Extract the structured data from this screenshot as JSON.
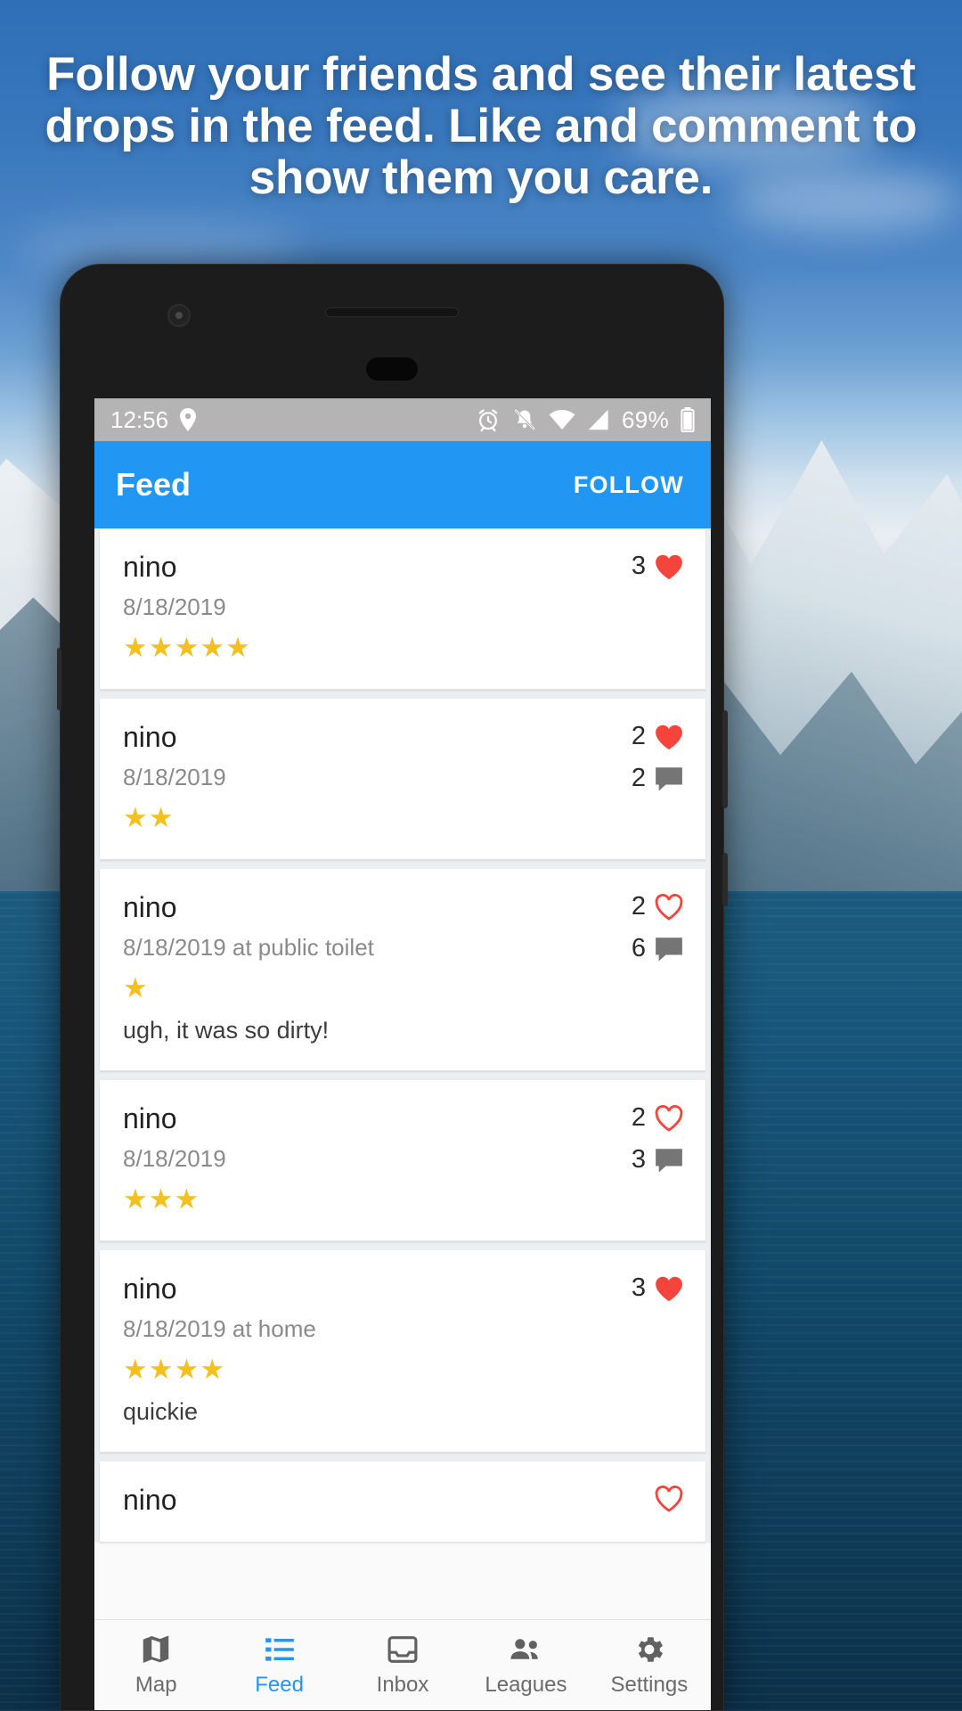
{
  "promo": {
    "headline": "Follow your friends and see their latest drops in the feed. Like and comment to show them you care."
  },
  "colors": {
    "accent": "#2196f3",
    "star": "#f4c01f",
    "heart": "#f4443c",
    "statusbar": "#b4b4b4"
  },
  "status_bar": {
    "time": "12:56",
    "location_icon": "location-pin-icon",
    "alarm_icon": "alarm-clock-icon",
    "notifications_icon": "bell-muted-icon",
    "wifi_icon": "wifi-icon",
    "signal_icon": "cell-signal-icon",
    "battery_percent": "69%",
    "battery_icon": "battery-icon"
  },
  "appbar": {
    "title": "Feed",
    "follow_label": "FOLLOW"
  },
  "feed": [
    {
      "user": "nino",
      "meta": "8/18/2019",
      "stars": 5,
      "note": "",
      "likes": "3",
      "liked": true,
      "comments": ""
    },
    {
      "user": "nino",
      "meta": "8/18/2019",
      "stars": 2,
      "note": "",
      "likes": "2",
      "liked": true,
      "comments": "2"
    },
    {
      "user": "nino",
      "meta": "8/18/2019 at public toilet",
      "stars": 1,
      "note": "ugh, it was so dirty!",
      "likes": "2",
      "liked": false,
      "comments": "6"
    },
    {
      "user": "nino",
      "meta": "8/18/2019",
      "stars": 3,
      "note": "",
      "likes": "2",
      "liked": false,
      "comments": "3"
    },
    {
      "user": "nino",
      "meta": "8/18/2019 at home",
      "stars": 4,
      "note": "quickie",
      "likes": "3",
      "liked": true,
      "comments": ""
    },
    {
      "user": "nino",
      "meta": "",
      "stars": 0,
      "note": "",
      "likes": "",
      "liked": false,
      "comments": ""
    }
  ],
  "bottom_nav": [
    {
      "label": "Map",
      "icon": "map-icon",
      "active": false
    },
    {
      "label": "Feed",
      "icon": "feed-list-icon",
      "active": true
    },
    {
      "label": "Inbox",
      "icon": "inbox-icon",
      "active": false
    },
    {
      "label": "Leagues",
      "icon": "people-icon",
      "active": false
    },
    {
      "label": "Settings",
      "icon": "gear-icon",
      "active": false
    }
  ]
}
